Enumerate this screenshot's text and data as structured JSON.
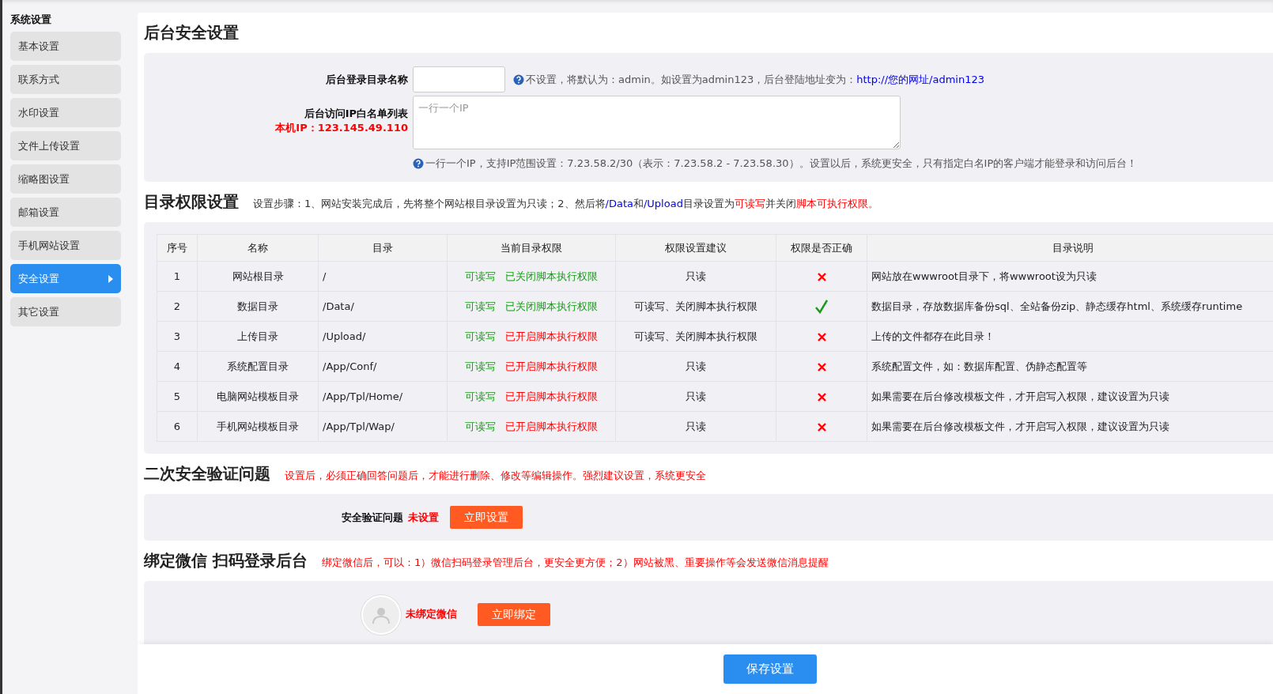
{
  "sidebar": {
    "title": "系统设置",
    "items": [
      {
        "label": "基本设置",
        "selected": false
      },
      {
        "label": "联系方式",
        "selected": false
      },
      {
        "label": "水印设置",
        "selected": false
      },
      {
        "label": "文件上传设置",
        "selected": false
      },
      {
        "label": "缩略图设置",
        "selected": false
      },
      {
        "label": "邮箱设置",
        "selected": false
      },
      {
        "label": "手机网站设置",
        "selected": false
      },
      {
        "label": "安全设置",
        "selected": true
      },
      {
        "label": "其它设置",
        "selected": false
      }
    ]
  },
  "page_title": "后台安全设置",
  "login_form": {
    "dir_label": "后台登录目录名称",
    "dir_hint": "不设置，将默认为：admin。如设置为admin123，后台登陆地址变为：",
    "dir_hint_link": "http://您的网址/admin123",
    "ip_label": "后台访问IP白名单列表",
    "local_ip": "本机IP：123.145.49.110",
    "ip_placeholder": "一行一个IP",
    "ip_hint": "一行一个IP，支持IP范围设置：7.23.58.2/30（表示：7.23.58.2 - 7.23.58.30）。设置以后，系统更安全，只有指定白名IP的客户端才能登录和访问后台！"
  },
  "permissions": {
    "title": "目录权限设置",
    "steps": [
      {
        "kind": "plain",
        "text": "设置步骤：1、网站安装完成后，先将整个网站根目录设置为只读；2、然后将"
      },
      {
        "kind": "link",
        "text": "/Data"
      },
      {
        "kind": "plain",
        "text": "和"
      },
      {
        "kind": "link",
        "text": "/Upload"
      },
      {
        "kind": "plain",
        "text": "目录设置为"
      },
      {
        "kind": "warn",
        "text": "可读写"
      },
      {
        "kind": "plain",
        "text": "并关闭"
      },
      {
        "kind": "warn",
        "text": "脚本可执行权限。"
      }
    ],
    "columns": [
      "序号",
      "名称",
      "目录",
      "当前目录权限",
      "权限设置建议",
      "权限是否正确",
      "目录说明"
    ],
    "rows": [
      {
        "no": "1",
        "name": "网站根目录",
        "dir": "/",
        "rw": "可读写",
        "script": "已关闭脚本执行权限",
        "script_safe": true,
        "advice": "只读",
        "correct": false,
        "note": "网站放在wwwroot目录下，将wwwroot设为只读"
      },
      {
        "no": "2",
        "name": "数据目录",
        "dir": "/Data/",
        "rw": "可读写",
        "script": "已关闭脚本执行权限",
        "script_safe": true,
        "advice": "可读写、关闭脚本执行权限",
        "correct": true,
        "note": "数据目录，存放数据库备份sql、全站备份zip、静态缓存html、系统缓存runtime"
      },
      {
        "no": "3",
        "name": "上传目录",
        "dir": "/Upload/",
        "rw": "可读写",
        "script": "已开启脚本执行权限",
        "script_safe": false,
        "advice": "可读写、关闭脚本执行权限",
        "correct": false,
        "note": "上传的文件都存在此目录！"
      },
      {
        "no": "4",
        "name": "系统配置目录",
        "dir": "/App/Conf/",
        "rw": "可读写",
        "script": "已开启脚本执行权限",
        "script_safe": false,
        "advice": "只读",
        "correct": false,
        "note": "系统配置文件，如：数据库配置、伪静态配置等"
      },
      {
        "no": "5",
        "name": "电脑网站模板目录",
        "dir": "/App/Tpl/Home/",
        "rw": "可读写",
        "script": "已开启脚本执行权限",
        "script_safe": false,
        "advice": "只读",
        "correct": false,
        "note": "如果需要在后台修改模板文件，才开启写入权限，建议设置为只读"
      },
      {
        "no": "6",
        "name": "手机网站模板目录",
        "dir": "/App/Tpl/Wap/",
        "rw": "可读写",
        "script": "已开启脚本执行权限",
        "script_safe": false,
        "advice": "只读",
        "correct": false,
        "note": "如果需要在后台修改模板文件，才开启写入权限，建议设置为只读"
      }
    ]
  },
  "question": {
    "title": "二次安全验证问题",
    "note": "设置后，必须正确回答问题后，才能进行删除、修改等编辑操作。强烈建议设置，系统更安全",
    "label": "安全验证问题",
    "status": "未设置",
    "button": "立即设置"
  },
  "wechat": {
    "title": "绑定微信 扫码登录后台",
    "note": "绑定微信后，可以：1）微信扫码登录管理后台，更安全更方便；2）网站被黑、重要操作等会发送微信消息提醒",
    "status": "未绑定微信",
    "button": "立即绑定"
  },
  "save_button": "保存设置"
}
